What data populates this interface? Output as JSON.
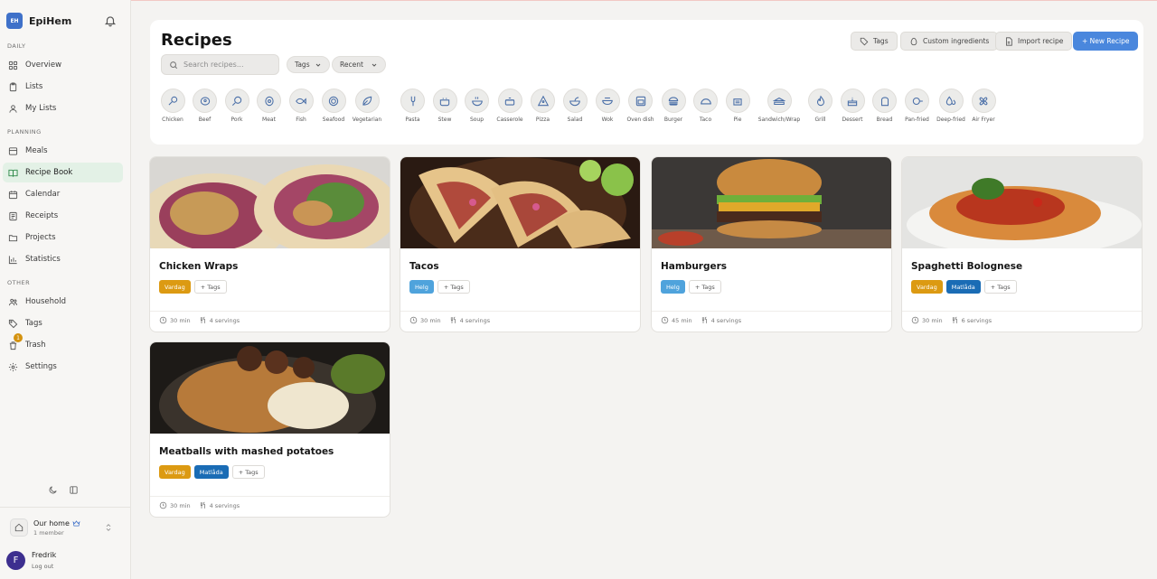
{
  "app": {
    "name": "EpiHem",
    "logo_text": "EH"
  },
  "sidebar": {
    "sections": {
      "daily": "DAILY",
      "planning": "PLANNING",
      "other": "OTHER"
    },
    "items": [
      {
        "label": "Overview",
        "icon": "grid-icon"
      },
      {
        "label": "Lists",
        "icon": "clipboard-icon"
      },
      {
        "label": "My Lists",
        "icon": "person-icon"
      },
      {
        "label": "Meals",
        "icon": "meals-icon"
      },
      {
        "label": "Recipe Book",
        "icon": "book-icon",
        "active": true
      },
      {
        "label": "Calendar",
        "icon": "calendar-icon"
      },
      {
        "label": "Receipts",
        "icon": "receipt-icon"
      },
      {
        "label": "Projects",
        "icon": "folder-icon"
      },
      {
        "label": "Statistics",
        "icon": "chart-icon"
      },
      {
        "label": "Household",
        "icon": "people-icon"
      },
      {
        "label": "Tags",
        "icon": "tag-icon"
      },
      {
        "label": "Trash",
        "icon": "trash-icon",
        "badge": "1"
      },
      {
        "label": "Settings",
        "icon": "gear-icon"
      }
    ],
    "household": {
      "name": "Our home",
      "members": "1 member"
    },
    "user": {
      "name": "Fredrik",
      "initial": "F",
      "logout": "Log out"
    }
  },
  "main": {
    "title": "Recipes",
    "search_placeholder": "Search recipes...",
    "tags_filter": "Tags",
    "sort": "Recent",
    "buttons": {
      "tags": "Tags",
      "custom": "Custom ingredients",
      "import": "Import recipe",
      "new": "+ New Recipe"
    },
    "categories": [
      "Chicken",
      "Beef",
      "Pork",
      "Meat",
      "Fish",
      "Seafood",
      "Vegetarian",
      "Pasta",
      "Stew",
      "Soup",
      "Casserole",
      "Pizza",
      "Salad",
      "Wok",
      "Oven dish",
      "Burger",
      "Taco",
      "Pie",
      "Sandwich/Wrap",
      "Grill",
      "Dessert",
      "Bread",
      "Pan-fried",
      "Deep-fried",
      "Air Fryer"
    ]
  },
  "recipes": [
    {
      "title": "Chicken Wraps",
      "tags": [
        "Vardag"
      ],
      "time": "30 min",
      "servings": "4 servings"
    },
    {
      "title": "Tacos",
      "tags": [
        "Helg"
      ],
      "time": "30 min",
      "servings": "4 servings"
    },
    {
      "title": "Hamburgers",
      "tags": [
        "Helg"
      ],
      "time": "45 min",
      "servings": "4 servings"
    },
    {
      "title": "Spaghetti Bolognese",
      "tags": [
        "Vardag",
        "Matlåda"
      ],
      "time": "30 min",
      "servings": "6 servings"
    },
    {
      "title": "Meatballs with mashed potatoes",
      "tags": [
        "Vardag",
        "Matlåda"
      ],
      "time": "30 min",
      "servings": "4 servings"
    }
  ],
  "add_tags_label": "+ Tags",
  "colors": {
    "accent": "#4a87dd",
    "active_nav": "#e3f1e6",
    "vardag": "#dc9a12",
    "helg": "#4fa3dc",
    "matlada": "#1a6cb5"
  }
}
